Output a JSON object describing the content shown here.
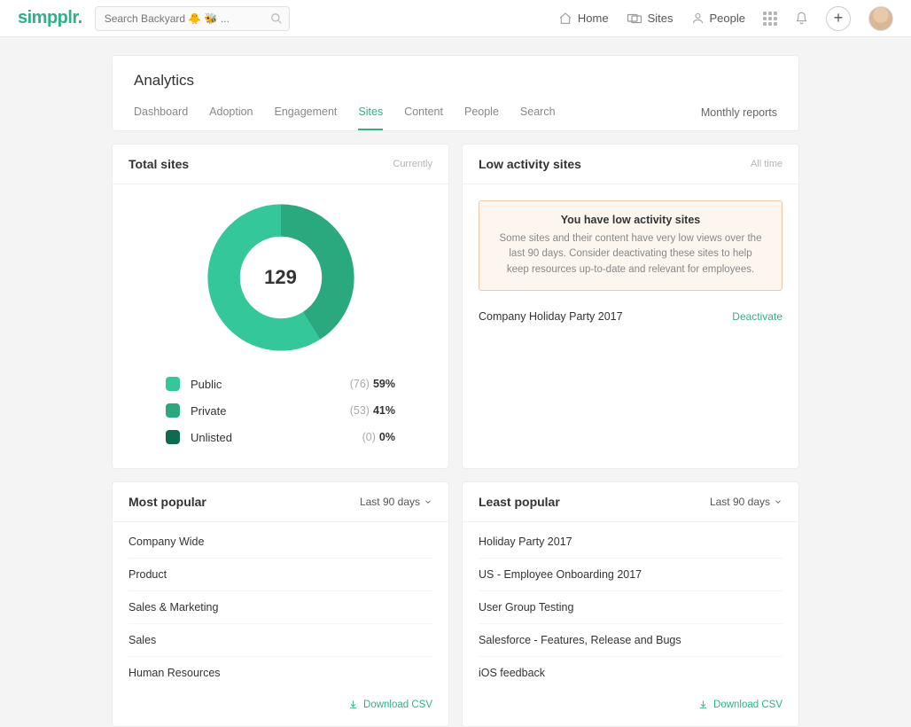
{
  "brand": "simpplr.",
  "search": {
    "placeholder": "Search Backyard 🐥 🐝 ..."
  },
  "topnav": {
    "home": "Home",
    "sites": "Sites",
    "people": "People"
  },
  "page": {
    "title": "Analytics",
    "tabs": [
      "Dashboard",
      "Adoption",
      "Engagement",
      "Sites",
      "Content",
      "People",
      "Search"
    ],
    "active_tab": 3,
    "right_link": "Monthly reports"
  },
  "total_sites": {
    "title": "Total sites",
    "subtitle": "Currently",
    "center_value": "129",
    "legend": [
      {
        "label": "Public",
        "count": "(76)",
        "pct": "59%",
        "color": "#33c79a"
      },
      {
        "label": "Private",
        "count": "(53)",
        "pct": "41%",
        "color": "#2aa97f"
      },
      {
        "label": "Unlisted",
        "count": "(0)",
        "pct": "0%",
        "color": "#0e6b50"
      }
    ]
  },
  "low_activity": {
    "title": "Low activity sites",
    "subtitle": "All time",
    "warn_title": "You have low activity sites",
    "warn_body": "Some sites and their content have very low views over the last 90 days. Consider deactivating these sites to help keep resources up-to-date and relevant for employees.",
    "rows": [
      {
        "name": "Company Holiday Party 2017",
        "action": "Deactivate"
      }
    ]
  },
  "most_popular": {
    "title": "Most popular",
    "range": "Last 90 days",
    "items": [
      "Company Wide",
      "Product",
      "Sales & Marketing",
      "Sales",
      "Human Resources"
    ],
    "csv": "Download CSV"
  },
  "least_popular": {
    "title": "Least popular",
    "range": "Last 90 days",
    "items": [
      "Holiday Party 2017",
      "US - Employee Onboarding 2017",
      "User Group Testing",
      "Salesforce - Features, Release and Bugs",
      "iOS feedback"
    ],
    "csv": "Download CSV"
  },
  "chart_data": {
    "type": "pie",
    "title": "Total sites",
    "categories": [
      "Public",
      "Private",
      "Unlisted"
    ],
    "values": [
      76,
      53,
      0
    ],
    "percentages": [
      59,
      41,
      0
    ],
    "total": 129,
    "colors": [
      "#33c79a",
      "#2aa97f",
      "#0e6b50"
    ]
  }
}
